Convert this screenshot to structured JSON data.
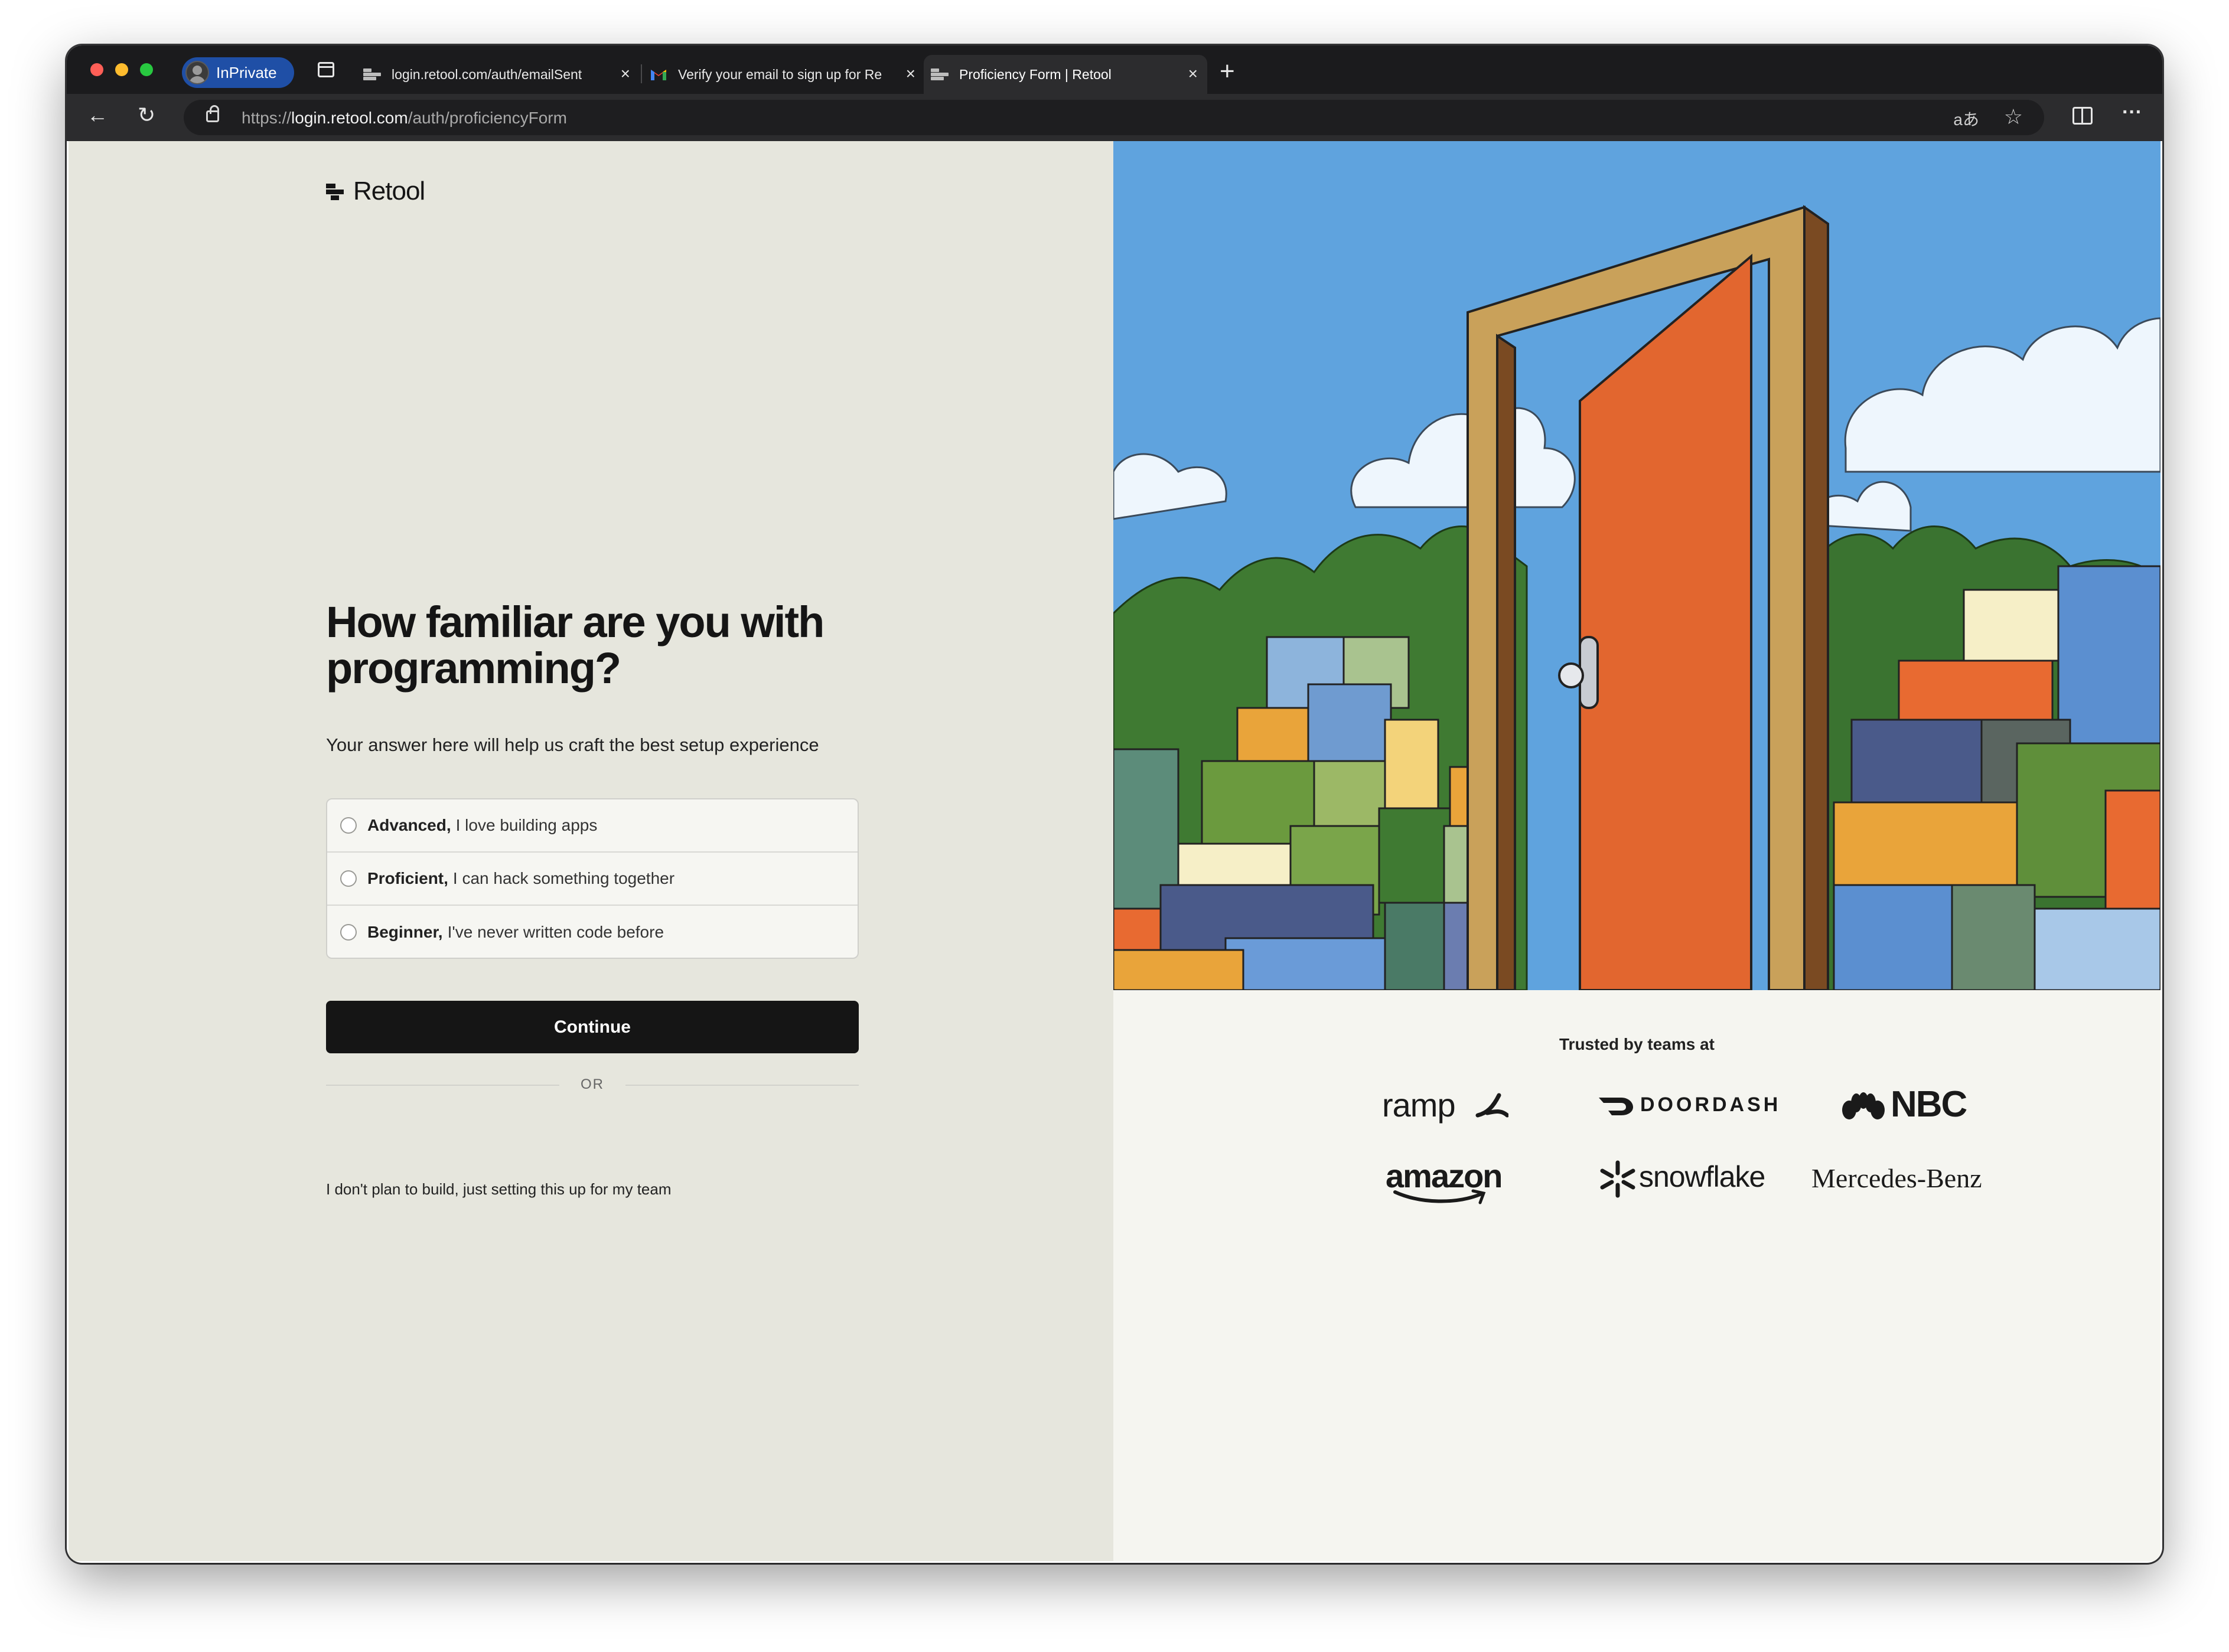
{
  "browser": {
    "profile_label": "InPrivate",
    "tabs": [
      {
        "title": "login.retool.com/auth/emailSent",
        "close": "×"
      },
      {
        "title": "Verify your email to sign up for Retool",
        "close": "×"
      },
      {
        "title": "Proficiency Form | Retool",
        "close": "×"
      }
    ],
    "new_tab": "+",
    "url_scheme": "https://",
    "url_host": "login.retool.com",
    "url_path": "/auth/proficiencyForm",
    "read_aloud": "aあ",
    "back": "←",
    "refresh": "↻",
    "favorite": "☆",
    "more": "···"
  },
  "page": {
    "logo_text": "Retool",
    "heading": "How familiar are you with programming?",
    "subtext": "Your answer here will help us craft the best setup experience",
    "options": [
      {
        "bold": "Advanced,",
        "text": "I love building apps"
      },
      {
        "bold": "Proficient,",
        "text": "I can hack something together"
      },
      {
        "bold": "Beginner,",
        "text": "I've never written code before"
      }
    ],
    "continue_label": "Continue",
    "or_label": "OR",
    "skip_link": "I don't plan to build, just setting this up for my team"
  },
  "trusted": {
    "label": "Trusted by teams at",
    "logos": [
      "ramp",
      "DOORDASH",
      "NBC",
      "amazon",
      "snowflake",
      "Mercedes-Benz"
    ]
  },
  "colors": {
    "accent": "#151515",
    "left_bg": "#e6e6dd",
    "right_bg": "#f5f5f0",
    "door": "#e2662f",
    "sky": "#5fa3de"
  }
}
